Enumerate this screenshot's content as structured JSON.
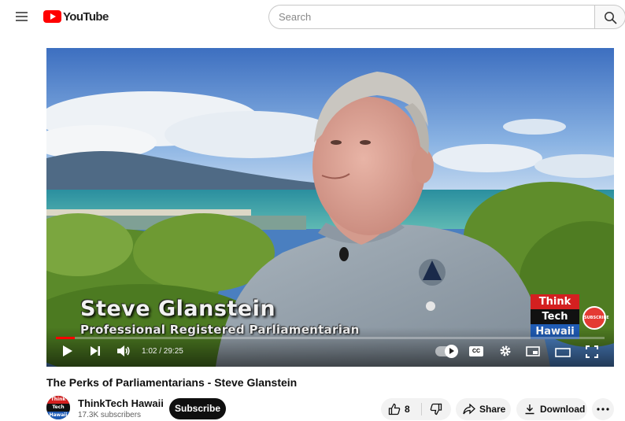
{
  "header": {
    "logo_text": "YouTube",
    "search_placeholder": "Search"
  },
  "video": {
    "lower_third": {
      "name": "Steve Glanstein",
      "title": "Professional Registered Parliamentarian"
    },
    "channel_bug": {
      "line1": "Think",
      "line2": "Tech",
      "line3": "Hawaii",
      "subscribe_badge": "SUBSCRIBE"
    },
    "player": {
      "time_display": "1:02 / 29:25",
      "progress": 0.035,
      "cc_label": "CC"
    }
  },
  "meta": {
    "title": "The Perks of Parliamentarians - Steve Glanstein",
    "channel_name": "ThinkTech Hawaii",
    "subscribers": "17.3K subscribers",
    "subscribe_label": "Subscribe",
    "likes": "8",
    "share_label": "Share",
    "download_label": "Download"
  },
  "colors": {
    "brand_red": "#ff0000",
    "subscribe_bg": "#0f0f0f",
    "pill_bg": "#f2f2f2"
  }
}
